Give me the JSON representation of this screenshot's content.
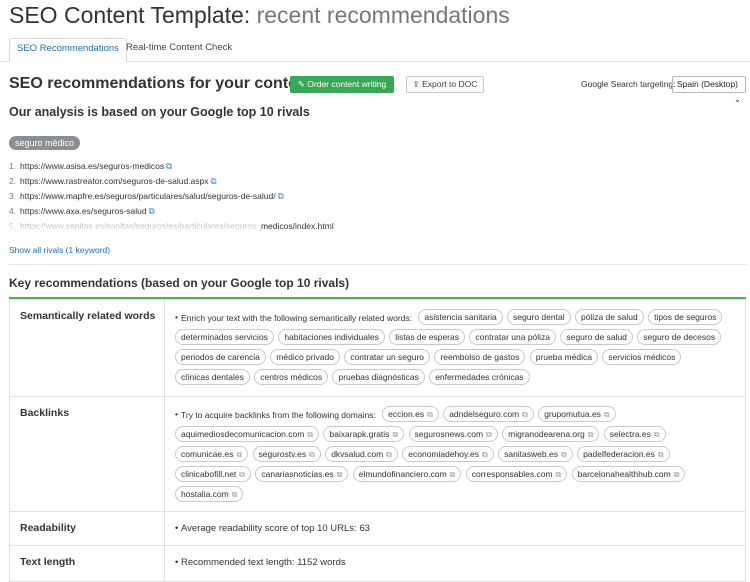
{
  "header": {
    "title_main": "SEO Content Template:",
    "title_sub": "recent recommendations"
  },
  "tabs": [
    {
      "label": "SEO Recommendations"
    },
    {
      "label": "Real-time Content Check"
    }
  ],
  "section": {
    "heading": "SEO recommendations for your content",
    "order_button": "Order content writing",
    "export_button": "Export to DOC",
    "targeting_label": "Google Search targeting:",
    "targeting_value": "Spain (Desktop)"
  },
  "analysis": {
    "heading": "Our analysis is based on your Google top 10 rivals",
    "keyword": "seguro médico",
    "rivals": [
      {
        "n": "1.",
        "url": "https://www.asisa.es/seguros-medicos"
      },
      {
        "n": "2.",
        "url": "https://www.rastreator.com/seguros-de-salud.aspx"
      },
      {
        "n": "3.",
        "url": "https://www.mapfre.es/seguros/particulares/salud/seguros-de-salud/"
      },
      {
        "n": "4.",
        "url": "https://www.axa.es/seguros-salud"
      },
      {
        "n": "5.",
        "url": "https://www.sanitas.es/sanitas/seguros/es/particulares/seguros_medicos/index.html"
      }
    ],
    "show_all": "Show all rivals (1 keyword)"
  },
  "key": {
    "heading": "Key recommendations (based on your Google top 10 rivals)",
    "semantic": {
      "label": "Semantically related words",
      "intro": "Enrich your text with the following semantically related words:",
      "words": [
        "asistencia sanitaria",
        "seguro dental",
        "póliza de salud",
        "tipos de seguros",
        "determinados servicios",
        "habitaciones individuales",
        "listas de esperas",
        "contratar una póliza",
        "seguro de salud",
        "seguro de decesos",
        "periodos de carencia",
        "médico privado",
        "contratar un seguro",
        "reembolso de gastos",
        "prueba médica",
        "servicios médicos",
        "clínicas dentales",
        "centros médicos",
        "pruebas diagnósticas",
        "enfermedades crónicas"
      ]
    },
    "backlinks": {
      "label": "Backlinks",
      "intro": "Try to acquire backlinks from the following domains:",
      "domains": [
        "eccion.es",
        "adndelseguro.com",
        "grupomutua.es",
        "aquimediosdecomunicacion.com",
        "baixarapk.gratis",
        "segurosnews.com",
        "migranodearena.org",
        "selectra.es",
        "comunicae.es",
        "segurostv.es",
        "dkvsalud.com",
        "economiadehoy.es",
        "sanitasweb.es",
        "padelfederacion.es",
        "clinicabofill.net",
        "canariasnoticias.es",
        "elmundofinanciero.com",
        "corresponsables.com",
        "barcelonahealthhub.com",
        "hostalia.com"
      ]
    },
    "readability": {
      "label": "Readability",
      "text": "Average readability score of top 10 URLs:",
      "value": "63"
    },
    "text_length": {
      "label": "Text length",
      "text": "Recommended text length:",
      "value": "1152 words"
    }
  }
}
